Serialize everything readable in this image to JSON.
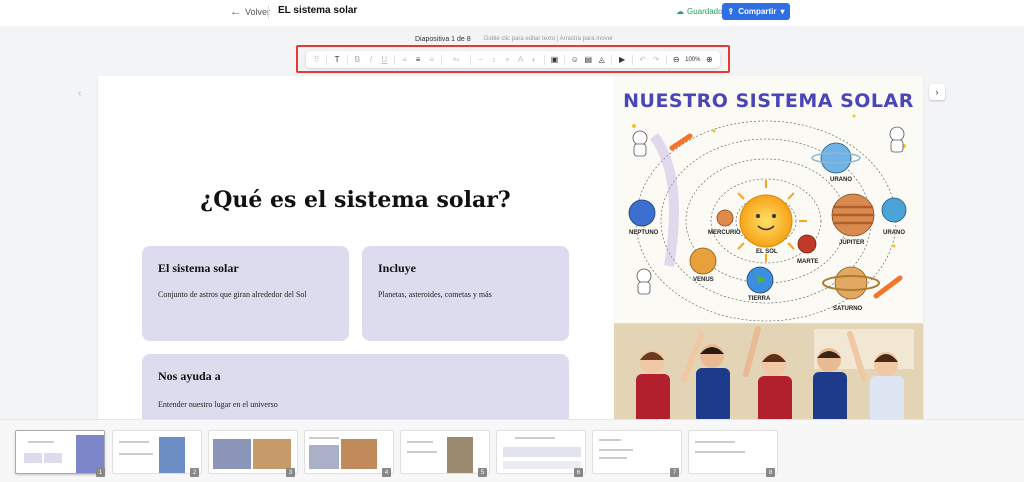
{
  "header": {
    "back_label": "Volver",
    "title": "EL sistema solar",
    "saved_label": "Guardado",
    "share_label": "Compartir"
  },
  "slide_info": {
    "position": "Diapositiva 1 de 8",
    "hint": "Doble clic para editar texto | Arrastra para mover"
  },
  "toolbar": {
    "zoom": "100%",
    "font_size": "Aa"
  },
  "slide": {
    "heading": "¿Qué es el sistema solar?",
    "cards": [
      {
        "title": "El sistema solar",
        "text": "Conjunto de astros que giran alrededor del Sol"
      },
      {
        "title": "Incluye",
        "text": "Planetas, asteroides, cometas y más"
      },
      {
        "title": "Nos ayuda a",
        "text": "Entender nuestro lugar en el universo"
      }
    ],
    "poster": {
      "title": "NUESTRO SISTEMA SOLAR",
      "labels": [
        "URANO",
        "NEPTUNO",
        "MERCURIO",
        "JÚPITER",
        "URANO",
        "EL SOL",
        "MARTE",
        "VENUS",
        "TIERRA",
        "SATURNO"
      ]
    }
  },
  "filmstrip": {
    "numbers": [
      "1",
      "2",
      "3",
      "4",
      "5",
      "6",
      "7",
      "8"
    ]
  },
  "colors": {
    "accent": "#2f6fe4",
    "saved": "#21a366",
    "highlight": "#e53935",
    "card_bg": "#dcdcee"
  }
}
